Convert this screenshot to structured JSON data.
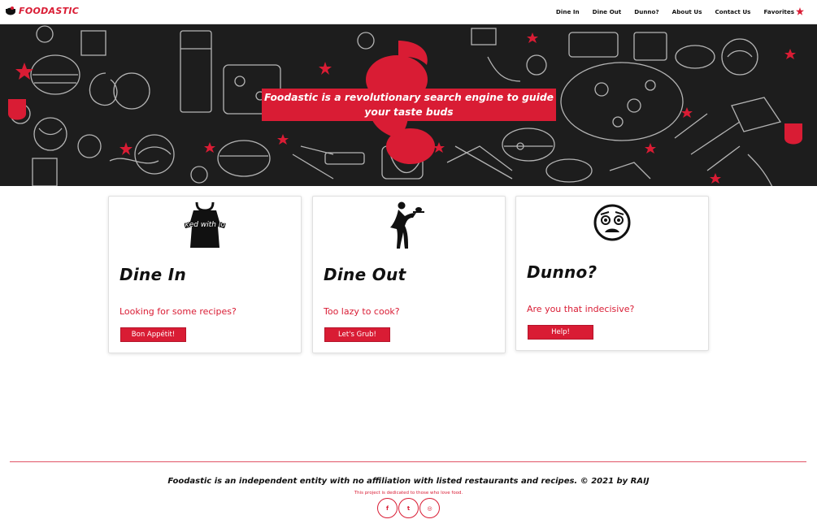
{
  "nav": {
    "logo_text": "FOODASTIC",
    "links": [
      {
        "label": "Dine In"
      },
      {
        "label": "Dine Out"
      },
      {
        "label": "Dunno?"
      },
      {
        "label": "About Us"
      },
      {
        "label": "Contact Us"
      },
      {
        "label": "Favorites"
      }
    ]
  },
  "hero": {
    "tagline_line1": "Foodastic is a revolutionary search engine to guide",
    "tagline_line2": "your taste buds"
  },
  "cards": [
    {
      "title": "Dine In",
      "text": "Looking for some recipes?",
      "button": "Bon Appétit!",
      "icon": "apron-icon",
      "apron_text": "baked with love"
    },
    {
      "title": "Dine Out",
      "text": "Too lazy to cook?",
      "button": "Let's Grub!",
      "icon": "waiter-icon"
    },
    {
      "title": "Dunno?",
      "text": "Are you that indecisive?",
      "button": "Help!",
      "icon": "confused-face-icon"
    }
  ],
  "footer": {
    "text": "Foodastic is an independent entity with no affiliation with listed restaurants and recipes. © 2021 by RAIJ",
    "sub": "This project is dedicated to those who love food.",
    "social": [
      {
        "icon": "facebook-icon",
        "glyph": "f"
      },
      {
        "icon": "twitter-icon",
        "glyph": "t"
      },
      {
        "icon": "instagram-icon",
        "glyph": "◎"
      }
    ]
  },
  "colors": {
    "accent": "#d91c34",
    "hero_bg": "#1d1d1d"
  }
}
